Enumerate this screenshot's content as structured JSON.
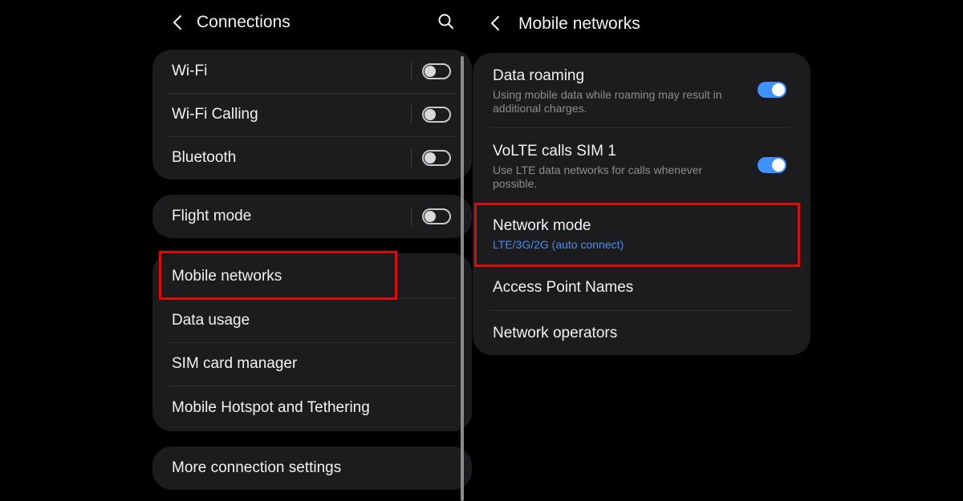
{
  "left_screen": {
    "header": {
      "title": "Connections",
      "back_icon": "chevron-left-icon",
      "search_icon": "search-icon"
    },
    "group_1": [
      {
        "label": "Wi-Fi",
        "toggle": "off"
      },
      {
        "label": "Wi-Fi Calling",
        "toggle": "off"
      },
      {
        "label": "Bluetooth",
        "toggle": "off"
      }
    ],
    "group_2": [
      {
        "label": "Flight mode",
        "toggle": "off"
      }
    ],
    "group_3": [
      {
        "label": "Mobile networks",
        "highlighted": true
      },
      {
        "label": "Data usage"
      },
      {
        "label": "SIM card manager"
      },
      {
        "label": "Mobile Hotspot and Tethering"
      }
    ],
    "group_4": [
      {
        "label": "More connection settings"
      }
    ]
  },
  "right_screen": {
    "header": {
      "title": "Mobile networks",
      "back_icon": "chevron-left-icon"
    },
    "items": [
      {
        "title": "Data roaming",
        "subtitle": "Using mobile data while roaming may result in additional charges.",
        "toggle": "on"
      },
      {
        "title": "VoLTE calls SIM 1",
        "subtitle": "Use LTE data networks for calls whenever possible.",
        "toggle": "on"
      },
      {
        "title": "Network mode",
        "value": "LTE/3G/2G (auto connect)",
        "highlighted": true
      },
      {
        "title": "Access Point Names"
      },
      {
        "title": "Network operators"
      }
    ]
  },
  "colors": {
    "background": "#000000",
    "card": "#1c1c1e",
    "toggle_on": "#3e91ff",
    "value_text": "#4b8df0",
    "highlight_box": "#d90d0d"
  }
}
